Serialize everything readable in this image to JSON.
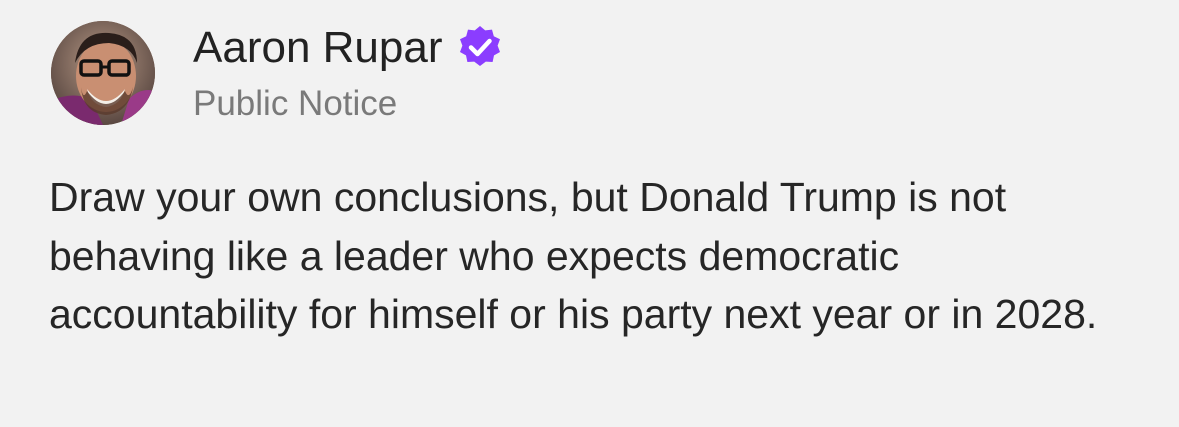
{
  "author": {
    "name": "Aaron Rupar",
    "publication": "Public Notice",
    "verified_color": "#8b3dff"
  },
  "post": {
    "text": "Draw your own conclusions, but Donald Trump is not behaving like a leader who expects democratic accountability for himself or his party next year or in 2028."
  },
  "icons": {
    "verified": "verified-check-badge-icon",
    "avatar": "profile-photo"
  },
  "colors": {
    "background": "#f2f2f2",
    "text": "#262626",
    "secondary_text": "#7a7a7a"
  }
}
